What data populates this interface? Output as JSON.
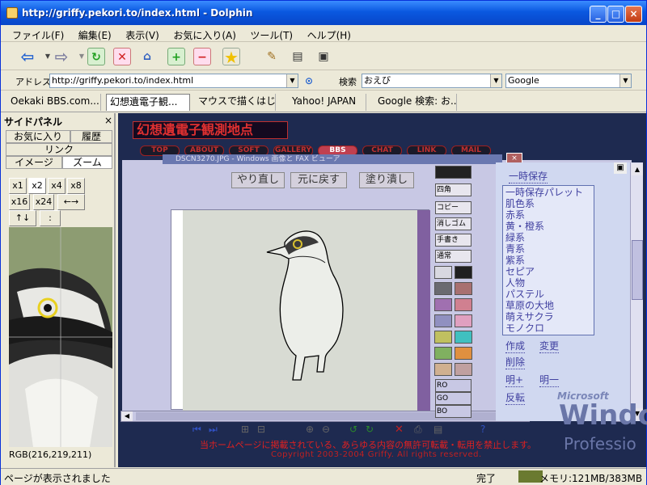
{
  "window": {
    "title": "http://griffy.pekori.to/index.html - Dolphin"
  },
  "menu": [
    "ファイル(F)",
    "編集(E)",
    "表示(V)",
    "お気に入り(A)",
    "ツール(T)",
    "ヘルプ(H)"
  ],
  "address": {
    "label": "アドレス",
    "url": "http://griffy.pekori.to/index.html",
    "search_label": "検索",
    "search_value": "おえび",
    "engine": "Google"
  },
  "tabs": [
    "Oekaki BBS.com...",
    "幻想遺電子観...",
    "マウスで描くはじ...",
    "Yahoo! JAPAN",
    "Google 検索: お..."
  ],
  "sidebar": {
    "title": "サイドパネル",
    "tabs": [
      "お気に入り",
      "履歴",
      "リンク",
      "イメージ",
      "ズーム"
    ],
    "zoom_buttons": [
      "x1",
      "x2",
      "x4",
      "x8",
      "x16",
      "x24",
      "←→",
      "↑↓",
      ":"
    ],
    "rgb": "RGB(216,219,211)"
  },
  "site": {
    "title": "幻想遺電子観測地点",
    "nav": [
      "TOP",
      "ABOUT",
      "SOFT",
      "GALLERY",
      "BBS",
      "CHAT",
      "LINK",
      "MAIL"
    ],
    "active": "BBS",
    "footer1": "当ホームページに掲載されている、あらゆる内容の無許可転載・転用を禁止します。",
    "footer2": "Copyright 2003-2004 Griffy. All rights reserved."
  },
  "paint": {
    "window_title": "DSCN3270.JPG - Windows 画像と FAX ビューア",
    "undo": "やり直し",
    "redo": "元に戻す",
    "fill": "塗り潰し",
    "tools": [
      "四角",
      "コピー",
      "消しゴム",
      "手書き",
      "通常"
    ],
    "rgb_labels": [
      "RO",
      "GO",
      "BO"
    ],
    "swatches": [
      "#d8d8e0",
      "#202020",
      "#6a6a70",
      "#a87070",
      "#a070b0",
      "#d08090",
      "#9090c0",
      "#e0a0c0",
      "#c0c060",
      "#40c0c0",
      "#80b060",
      "#e09040",
      "#d0b090",
      "#c0a0a0"
    ],
    "save_button": "一時保存",
    "palette_list": [
      "一時保存パレット",
      "肌色系",
      "赤系",
      "黄・橙系",
      "緑系",
      "青系",
      "紫系",
      "セピア",
      "人物",
      "パステル",
      "草原の大地",
      "萌えサクラ",
      "モノクロ"
    ],
    "buttons": [
      "作成",
      "変更",
      "削除",
      "明+",
      "明一",
      "反転"
    ]
  },
  "status": {
    "left": "ページが表示されました",
    "done": "完了",
    "memory": "メモリ:121MB/383MB"
  },
  "watermark": {
    "brand": "Microsoft",
    "os": "Windo",
    "edition": "Professio"
  }
}
